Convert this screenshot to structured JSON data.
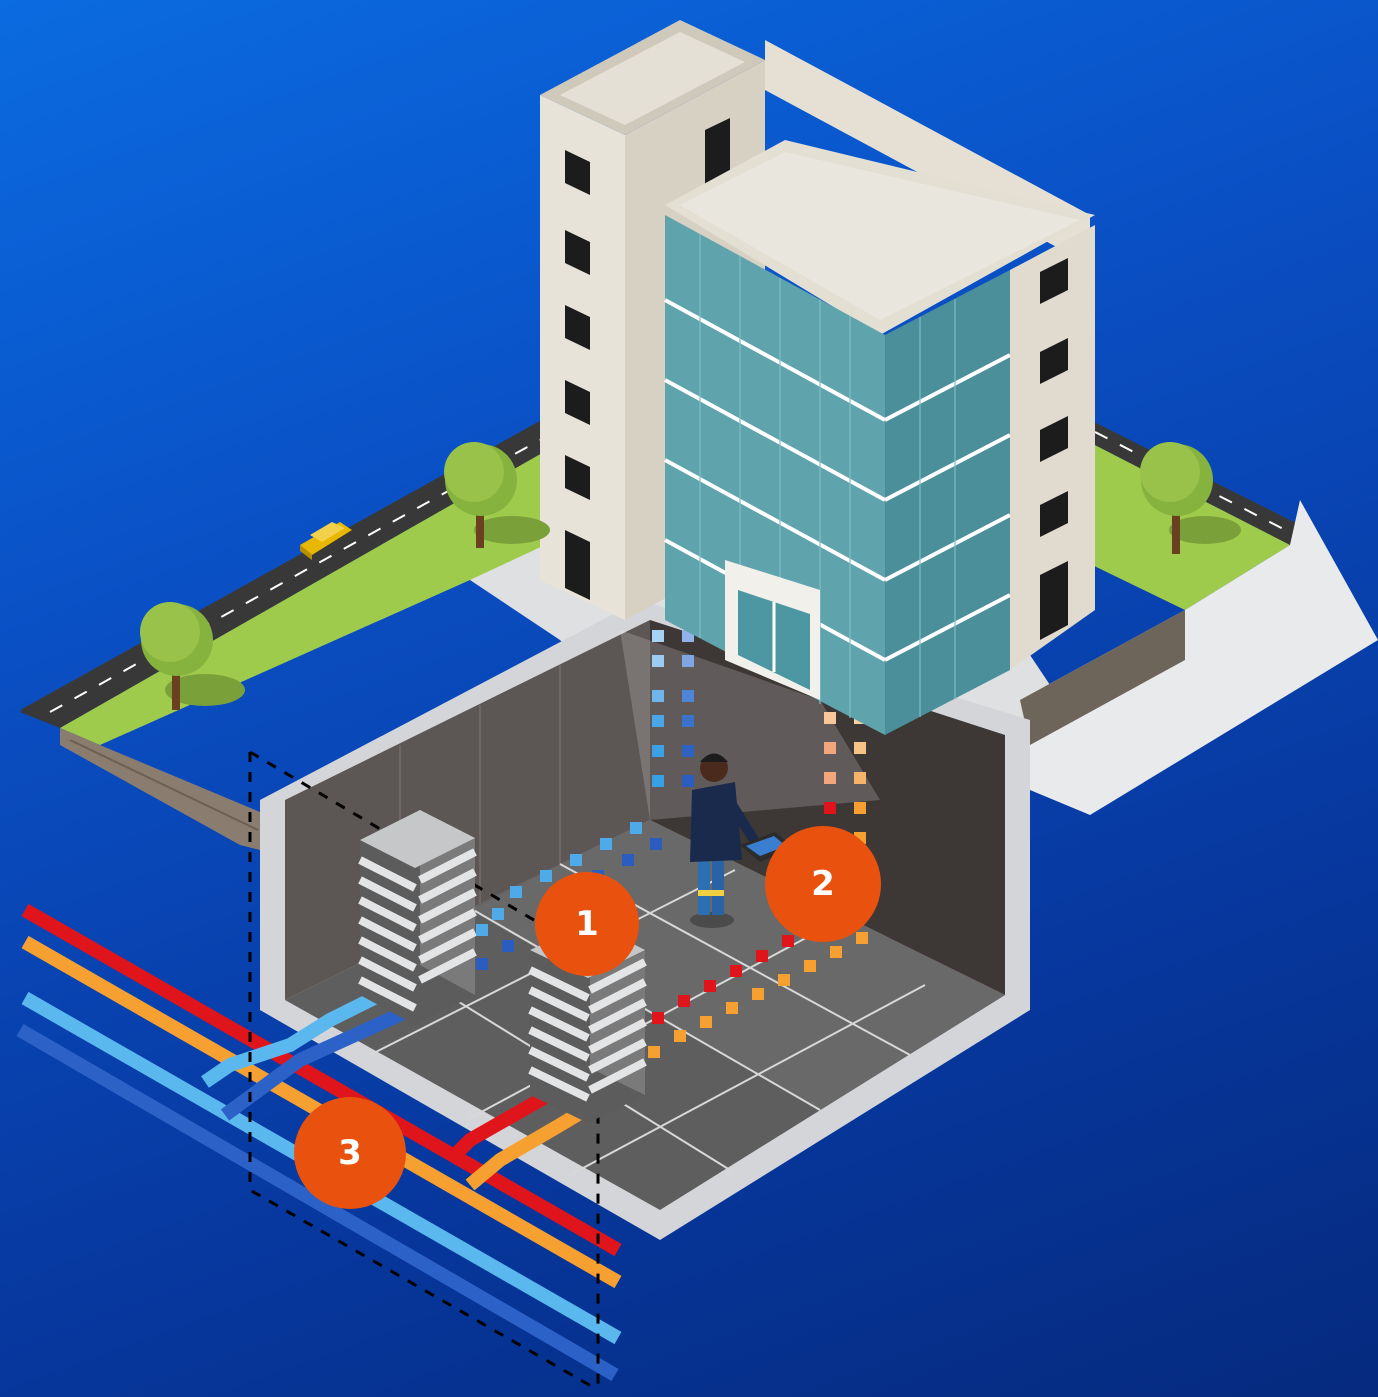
{
  "badges": [
    {
      "label": "1",
      "color": "#e8520e"
    },
    {
      "label": "2",
      "color": "#e8520e"
    },
    {
      "label": "3",
      "color": "#e8520e"
    }
  ],
  "colors": {
    "background": "#0a4fc4",
    "cable_red": "#e0141b",
    "cable_orange": "#f5a030",
    "cable_light_blue": "#5bb8ee",
    "cable_dark_blue": "#2c62c8",
    "grass": "#9fcb4c",
    "road": "#3a3a3a",
    "building_wall": "#e6e0d4",
    "glass": "#5fa3ad"
  },
  "icons": [
    "building-icon",
    "tree-icon",
    "car-icon",
    "server-rack-icon",
    "technician-icon",
    "tablet-icon",
    "cable-icon"
  ]
}
